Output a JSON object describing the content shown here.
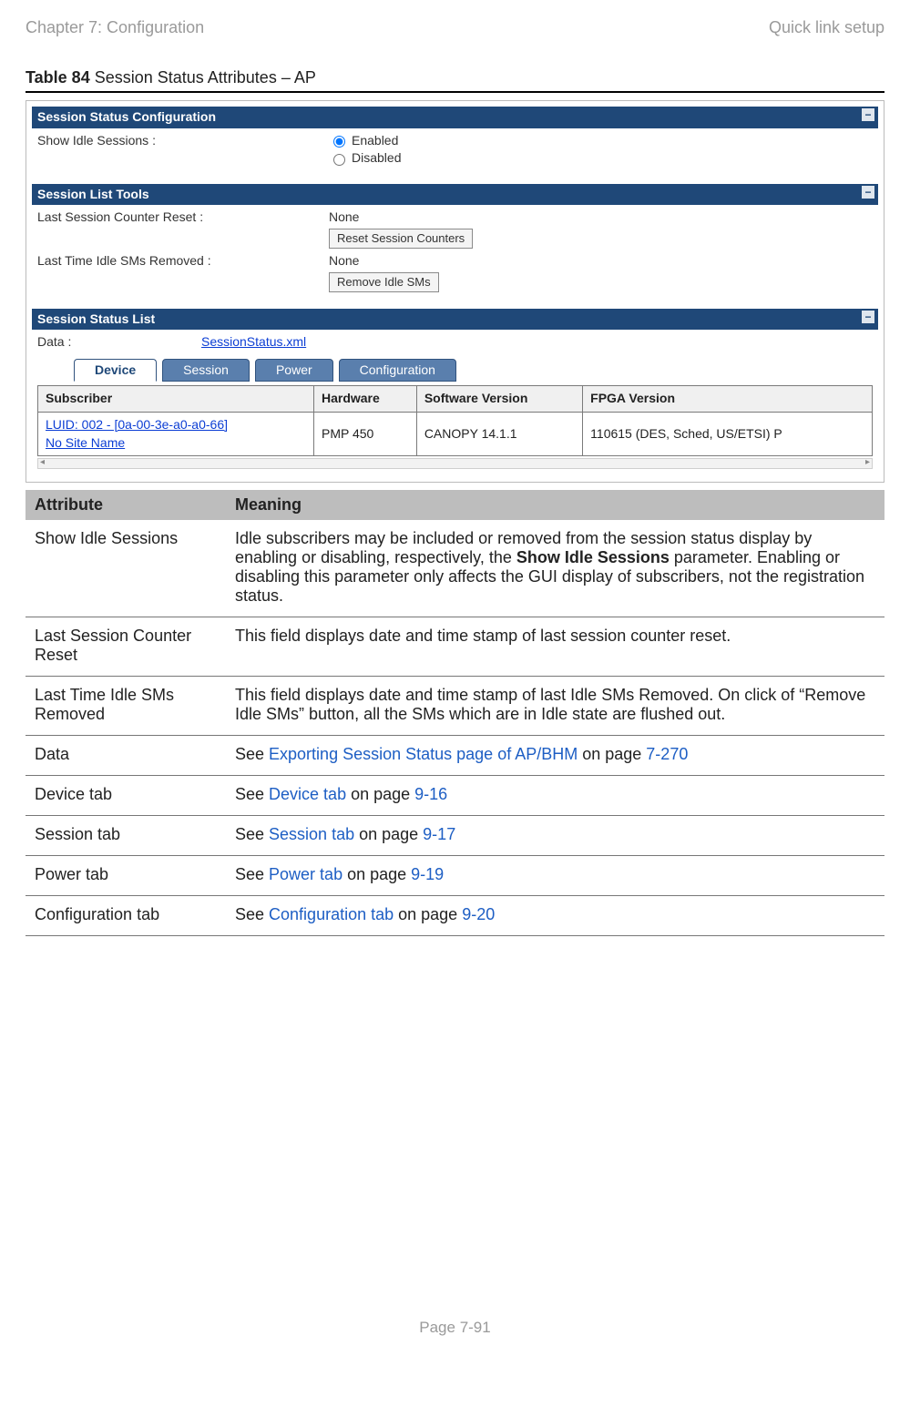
{
  "header": {
    "left": "Chapter 7:  Configuration",
    "right": "Quick link setup"
  },
  "caption": {
    "prefix": "Table 84",
    "rest": " Session Status Attributes – AP"
  },
  "panel1": {
    "title": "Session Status Configuration",
    "row_label": "Show Idle Sessions :",
    "enabled": "Enabled",
    "disabled": "Disabled"
  },
  "panel2": {
    "title": "Session List Tools",
    "row1_label": "Last Session Counter Reset :",
    "row1_val": "None",
    "row1_btn": "Reset Session Counters",
    "row2_label": "Last Time Idle SMs Removed :",
    "row2_val": "None",
    "row2_btn": "Remove Idle SMs"
  },
  "panel3": {
    "title": "Session Status List",
    "data_label": "Data :",
    "data_link": "SessionStatus.xml",
    "tabs": [
      "Device",
      "Session",
      "Power",
      "Configuration"
    ],
    "grid": {
      "headers": [
        "Subscriber",
        "Hardware",
        "Software Version",
        "FPGA Version"
      ],
      "row": {
        "sub_line1": "LUID: 002 - [0a-00-3e-a0-a0-66]",
        "sub_line2": "No Site Name",
        "hw": "PMP 450",
        "sw": "CANOPY 14.1.1",
        "fpga": "110615 (DES, Sched, US/ETSI) P"
      }
    }
  },
  "attrtable": {
    "headers": {
      "attr": "Attribute",
      "meaning": "Meaning"
    },
    "rows": [
      {
        "attr": "Show Idle Sessions",
        "meaning_pre": "Idle subscribers may be included or removed from the session status display by enabling or disabling, respectively, the ",
        "meaning_bold": "Show Idle Sessions",
        "meaning_post": " parameter. Enabling or disabling this parameter only affects the GUI display of subscribers, not the registration status."
      },
      {
        "attr": "Last Session Counter Reset",
        "meaning": "This field displays date and time stamp of last session counter reset."
      },
      {
        "attr": "Last Time Idle SMs Removed",
        "meaning": "This field displays date and time stamp of last Idle SMs Removed. On click of “Remove Idle SMs” button, all the SMs which are in Idle state are flushed out."
      },
      {
        "attr": "Data",
        "see": "See ",
        "link": "Exporting Session Status page of AP/BHM",
        "on": " on page ",
        "page": "7-270"
      },
      {
        "attr": "Device tab",
        "see": "See ",
        "link": "Device tab",
        "on": " on page ",
        "page": "9-16"
      },
      {
        "attr": "Session tab",
        "see": "See ",
        "link": "Session tab",
        "on": " on page ",
        "page": "9-17"
      },
      {
        "attr": "Power tab",
        "see": "See ",
        "link": "Power tab",
        "on": " on page ",
        "page": "9-19"
      },
      {
        "attr": "Configuration tab",
        "see": "See ",
        "link": "Configuration tab",
        "on": " on page ",
        "page": "9-20"
      }
    ]
  },
  "footer": "Page 7-91"
}
